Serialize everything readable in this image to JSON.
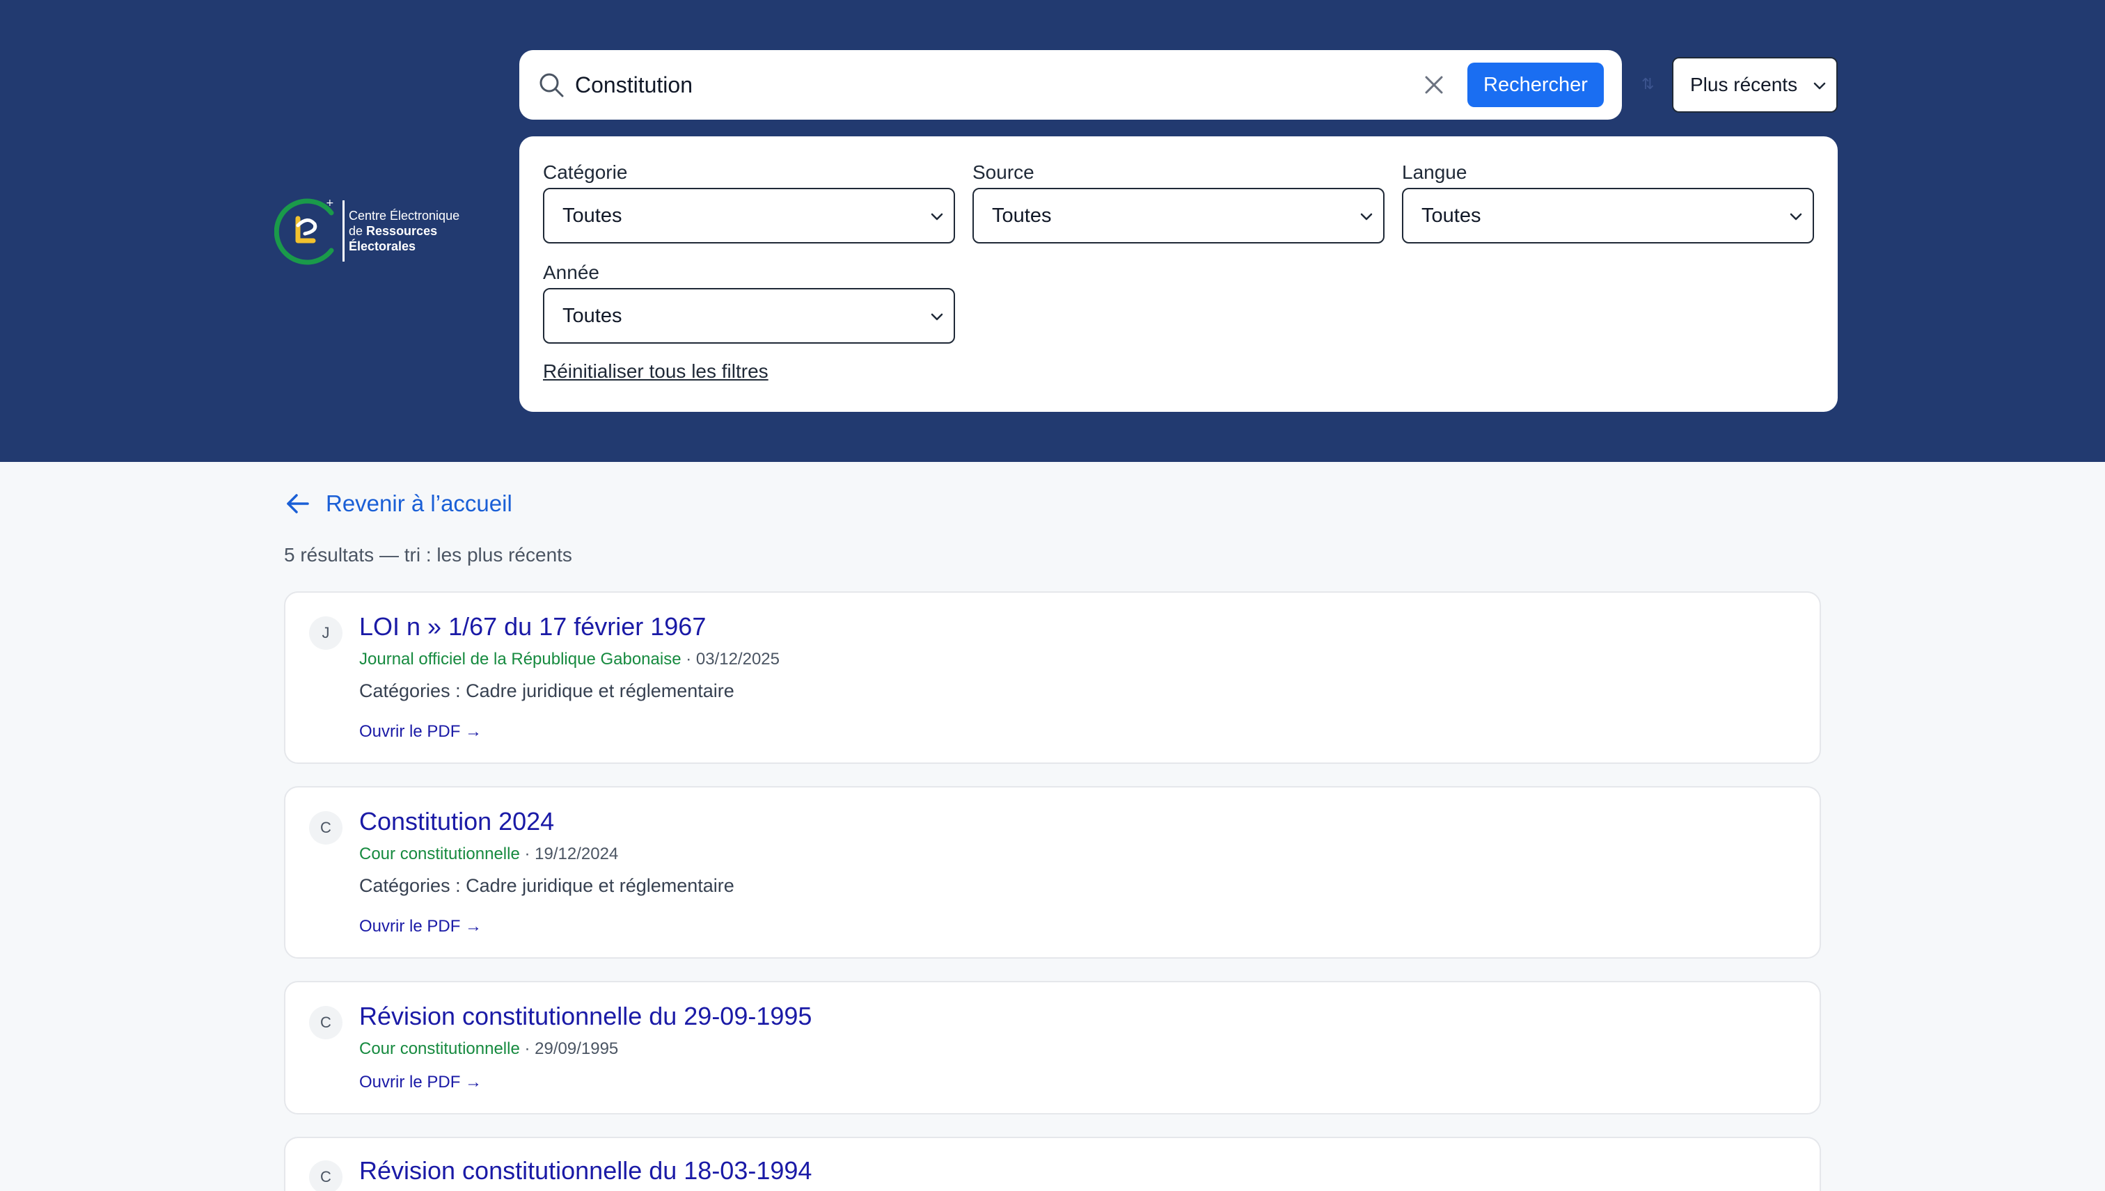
{
  "logo": {
    "line1": "Centre Électronique",
    "line2_prefix": "de ",
    "line2_bold": "Ressources",
    "line3": "Électorales",
    "colors": {
      "ring": "#1a9a4a",
      "mark": "#f2c12e",
      "text": "#ffffff"
    }
  },
  "search": {
    "value": "Constitution",
    "button_label": "Rechercher",
    "icon": "search-icon",
    "clear_icon": "close-icon"
  },
  "sort": {
    "selected": "Plus récents",
    "icon_glyph": "⇅"
  },
  "filters": {
    "category": {
      "label": "Catégorie",
      "selected": "Toutes"
    },
    "source": {
      "label": "Source",
      "selected": "Toutes"
    },
    "language": {
      "label": "Langue",
      "selected": "Toutes"
    },
    "year": {
      "label": "Année",
      "selected": "Toutes"
    },
    "reset_label": "Réinitialiser tous les filtres"
  },
  "nav": {
    "back_label": "Revenir à l’accueil"
  },
  "results": {
    "summary": "5 résultats — tri : les plus récents",
    "items": [
      {
        "badge": "J",
        "title": "LOI n » 1/67 du 17 février 1967",
        "source": "Journal officiel de la République Gabonaise",
        "date": " · 03/12/2025",
        "categories": "Catégories : Cadre juridique et réglementaire",
        "pdf_label": "Ouvrir le PDF →"
      },
      {
        "badge": "C",
        "title": "Constitution 2024",
        "source": "Cour constitutionnelle",
        "date": " · 19/12/2024",
        "categories": "Catégories : Cadre juridique et réglementaire",
        "pdf_label": "Ouvrir le PDF →"
      },
      {
        "badge": "C",
        "title": "Révision constitutionnelle du 29-09-1995",
        "source": "Cour constitutionnelle",
        "date": " · 29/09/1995",
        "pdf_label": "Ouvrir le PDF →"
      },
      {
        "badge": "C",
        "title": "Révision constitutionnelle du 18-03-1994"
      }
    ]
  },
  "colors": {
    "header_bg": "#223a70",
    "primary_button": "#1a6ef2",
    "link": "#1a5fd6",
    "title": "#1a1aa6",
    "source": "#168a3f",
    "page_bg": "#f6f8fa"
  }
}
